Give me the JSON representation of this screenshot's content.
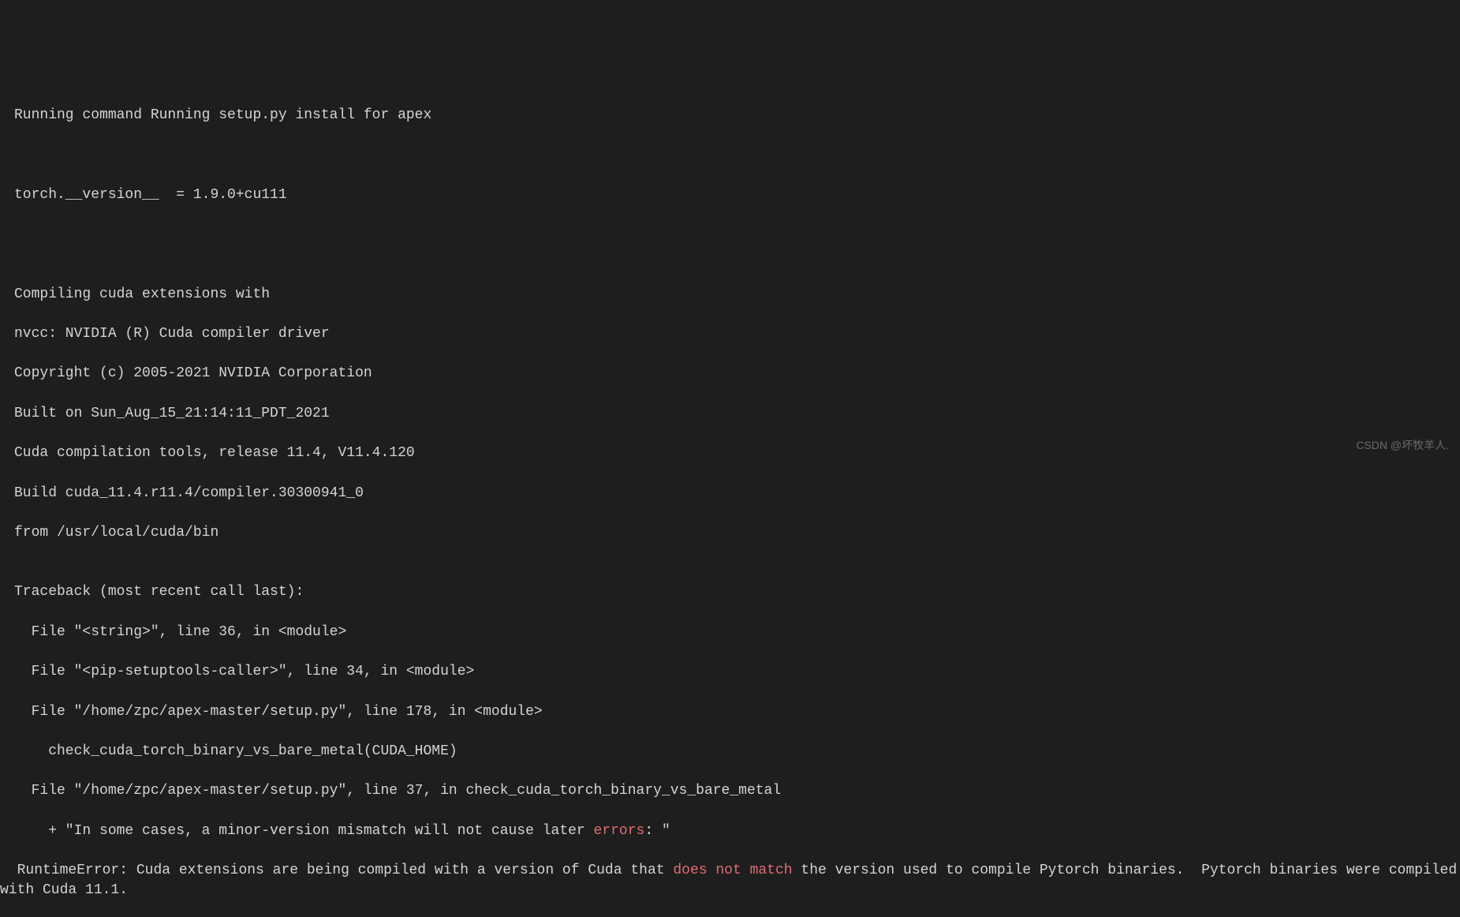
{
  "terminal": {
    "lines": {
      "l1": "Running command Running setup.py install for apex",
      "l2": "",
      "l3": "",
      "l4": "torch.__version__  = 1.9.0+cu111",
      "l5": "",
      "l6": "",
      "l7": "",
      "l8": "Compiling cuda extensions with",
      "l9": "nvcc: NVIDIA (R) Cuda compiler driver",
      "l10": "Copyright (c) 2005-2021 NVIDIA Corporation",
      "l11": "Built on Sun_Aug_15_21:14:11_PDT_2021",
      "l12": "Cuda compilation tools, release 11.4, V11.4.120",
      "l13": "Build cuda_11.4.r11.4/compiler.30300941_0",
      "l14": "from /usr/local/cuda/bin",
      "l15": "",
      "l16": "Traceback (most recent call last):",
      "l17": "  File \"<string>\", line 36, in <module>",
      "l18": "  File \"<pip-setuptools-caller>\", line 34, in <module>",
      "l19": "  File \"/home/zpc/apex-master/setup.py\", line 178, in <module>",
      "l20": "    check_cuda_torch_binary_vs_bare_metal(CUDA_HOME)",
      "l21": "  File \"/home/zpc/apex-master/setup.py\", line 37, in check_cuda_torch_binary_vs_bare_metal",
      "l22_a": "    + \"In some cases, a minor-version mismatch will not cause later ",
      "l22_b": "errors",
      "l22_c": ": \"",
      "l23_a": "  RuntimeError: Cuda extensions are being compiled with a version of Cuda that ",
      "l23_b": "does not match",
      "l23_c": " the version used to compile Pytorch binaries.  Pytorch binaries were compiled with Cuda 11.1."
    }
  },
  "watermark": "CSDN @坏牧羊人."
}
